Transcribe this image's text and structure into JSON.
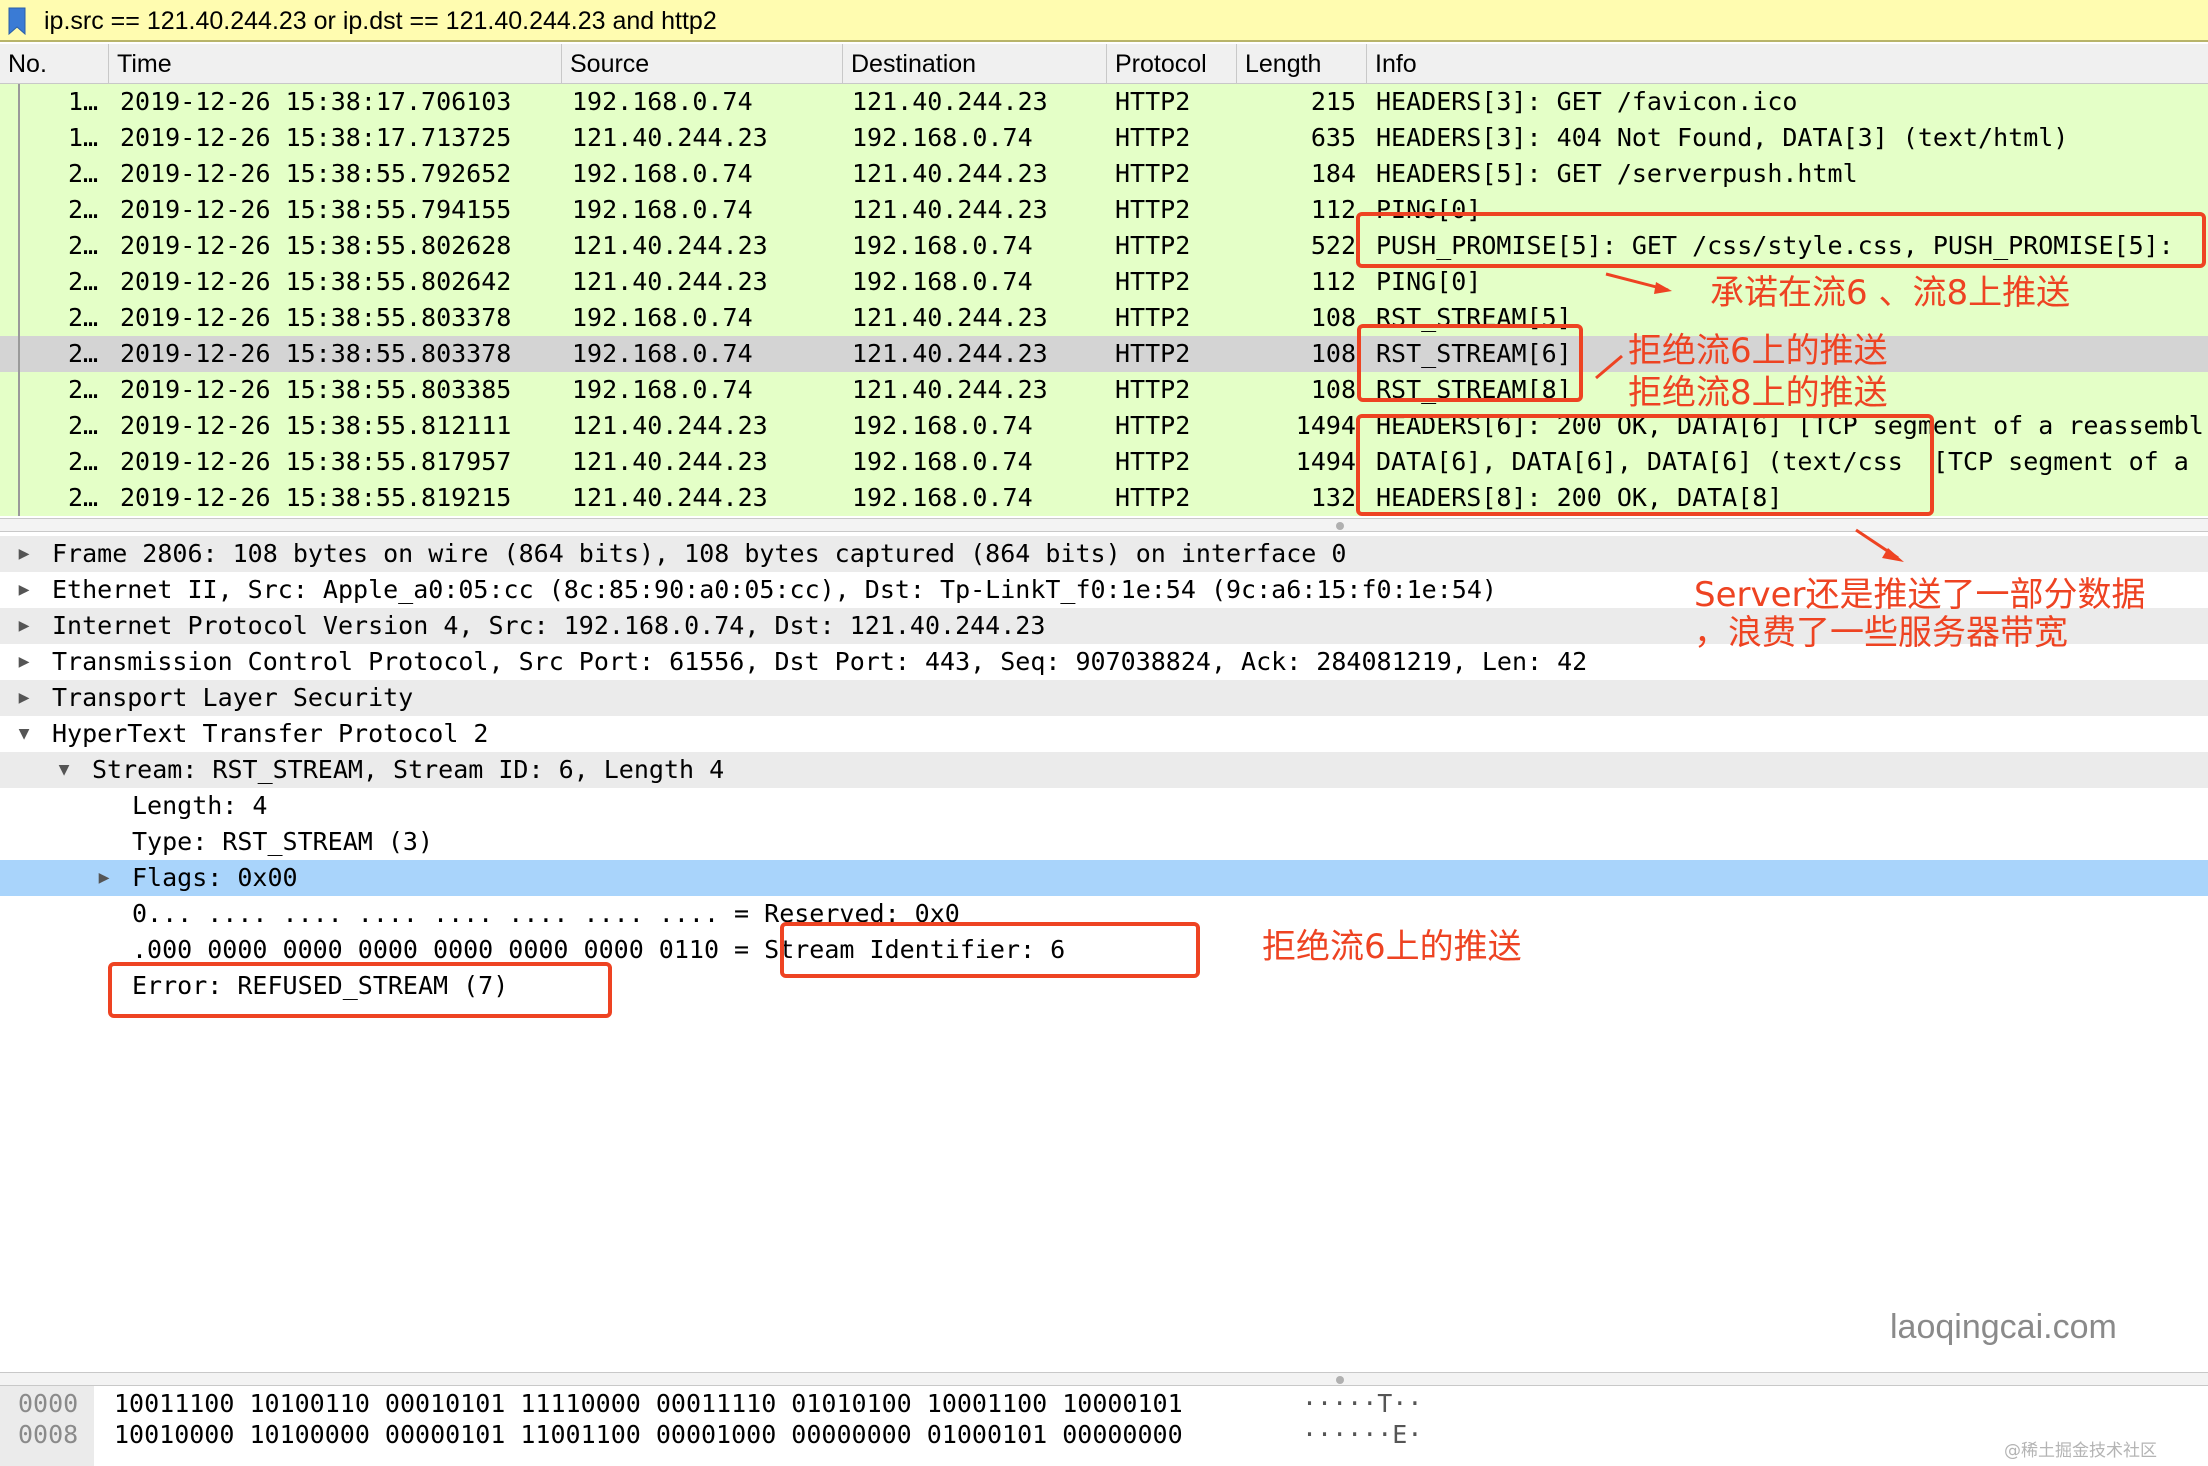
{
  "filter": {
    "expression": "ip.src == 121.40.244.23 or ip.dst == 121.40.244.23 and http2"
  },
  "columns": [
    "No.",
    "Time",
    "Source",
    "Destination",
    "Protocol",
    "Length",
    "Info"
  ],
  "packets": [
    {
      "no": "1…",
      "time": "2019-12-26 15:38:17.706103",
      "source": "192.168.0.74",
      "destination": "121.40.244.23",
      "protocol": "HTTP2",
      "length": "215",
      "info": "HEADERS[3]: GET /favicon.ico"
    },
    {
      "no": "1…",
      "time": "2019-12-26 15:38:17.713725",
      "source": "121.40.244.23",
      "destination": "192.168.0.74",
      "protocol": "HTTP2",
      "length": "635",
      "info": "HEADERS[3]: 404 Not Found, DATA[3] (text/html)"
    },
    {
      "no": "2…",
      "time": "2019-12-26 15:38:55.792652",
      "source": "192.168.0.74",
      "destination": "121.40.244.23",
      "protocol": "HTTP2",
      "length": "184",
      "info": "HEADERS[5]: GET /serverpush.html"
    },
    {
      "no": "2…",
      "time": "2019-12-26 15:38:55.794155",
      "source": "192.168.0.74",
      "destination": "121.40.244.23",
      "protocol": "HTTP2",
      "length": "112",
      "info": "PING[0]"
    },
    {
      "no": "2…",
      "time": "2019-12-26 15:38:55.802628",
      "source": "121.40.244.23",
      "destination": "192.168.0.74",
      "protocol": "HTTP2",
      "length": "522",
      "info": "PUSH_PROMISE[5]: GET /css/style.css, PUSH_PROMISE[5]:"
    },
    {
      "no": "2…",
      "time": "2019-12-26 15:38:55.802642",
      "source": "121.40.244.23",
      "destination": "192.168.0.74",
      "protocol": "HTTP2",
      "length": "112",
      "info": "PING[0]"
    },
    {
      "no": "2…",
      "time": "2019-12-26 15:38:55.803378",
      "source": "192.168.0.74",
      "destination": "121.40.244.23",
      "protocol": "HTTP2",
      "length": "108",
      "info": "RST_STREAM[5]"
    },
    {
      "no": "2…",
      "time": "2019-12-26 15:38:55.803378",
      "source": "192.168.0.74",
      "destination": "121.40.244.23",
      "protocol": "HTTP2",
      "length": "108",
      "info": "RST_STREAM[6]"
    },
    {
      "no": "2…",
      "time": "2019-12-26 15:38:55.803385",
      "source": "192.168.0.74",
      "destination": "121.40.244.23",
      "protocol": "HTTP2",
      "length": "108",
      "info": "RST_STREAM[8]"
    },
    {
      "no": "2…",
      "time": "2019-12-26 15:38:55.812111",
      "source": "121.40.244.23",
      "destination": "192.168.0.74",
      "protocol": "HTTP2",
      "length": "1494",
      "info": "HEADERS[6]: 200 OK, DATA[6] [TCP segment of a reassembl"
    },
    {
      "no": "2…",
      "time": "2019-12-26 15:38:55.817957",
      "source": "121.40.244.23",
      "destination": "192.168.0.74",
      "protocol": "HTTP2",
      "length": "1494",
      "info": "DATA[6], DATA[6], DATA[6] (text/css  [TCP segment of a"
    },
    {
      "no": "2…",
      "time": "2019-12-26 15:38:55.819215",
      "source": "121.40.244.23",
      "destination": "192.168.0.74",
      "protocol": "HTTP2",
      "length": "132",
      "info": "HEADERS[8]: 200 OK, DATA[8]"
    }
  ],
  "selected_packet": 7,
  "detail": [
    {
      "text": "Frame 2806: 108 bytes on wire (864 bits), 108 bytes captured (864 bits) on interface 0",
      "expander": "collapsed"
    },
    {
      "text": "Ethernet II, Src: Apple_a0:05:cc (8c:85:90:a0:05:cc), Dst: Tp-LinkT_f0:1e:54 (9c:a6:15:f0:1e:54)",
      "expander": "collapsed"
    },
    {
      "text": "Internet Protocol Version 4, Src: 192.168.0.74, Dst: 121.40.244.23",
      "expander": "collapsed"
    },
    {
      "text": "Transmission Control Protocol, Src Port: 61556, Dst Port: 443, Seq: 907038824, Ack: 284081219, Len: 42",
      "expander": "collapsed"
    },
    {
      "text": "Transport Layer Security",
      "expander": "collapsed"
    },
    {
      "text": "HyperText Transfer Protocol 2",
      "expander": "expanded"
    },
    {
      "text": "Stream: RST_STREAM, Stream ID: 6, Length 4",
      "expander": "expanded"
    },
    {
      "text": "Length: 4",
      "expander": "none"
    },
    {
      "text": "Type: RST_STREAM (3)",
      "expander": "none"
    },
    {
      "text": "Flags: 0x00",
      "expander": "collapsed"
    },
    {
      "text": "0... .... .... .... .... .... .... .... = Reserved: 0x0",
      "expander": "none"
    },
    {
      "text": ".000 0000 0000 0000 0000 0000 0000 0110 = Stream Identifier: 6",
      "expander": "none"
    },
    {
      "text": "Error: REFUSED_STREAM (7)",
      "expander": "none"
    }
  ],
  "bytes": [
    {
      "offset": "0000",
      "hex": "10011100 10100110 00010101 11110000 00011110 01010100 10001100 10000101",
      "ascii": "·····T··"
    },
    {
      "offset": "0008",
      "hex": "10010000 10100000 00000101 11001100 00001000 00000000 01000101 00000000",
      "ascii": "······E·"
    }
  ],
  "annotations": {
    "push_promise": "承诺在流6 、流8上推送",
    "reject6": "拒绝流6上的推送",
    "reject8": "拒绝流8上的推送",
    "server_push_1": "Server还是推送了一部分数据",
    "server_push_2": "，浪费了一些服务器带宽",
    "reject6_detail": "拒绝流6上的推送"
  },
  "watermark": "laoqingcai.com",
  "credit": "@稀土掘金技术社区",
  "colors": {
    "filter_bg": "#fffcb0",
    "row_bg": "#e4ffc7",
    "row_selected": "#d4d4d4",
    "detail_selected": "#a9d4fb",
    "annotation": "#ee4322"
  }
}
